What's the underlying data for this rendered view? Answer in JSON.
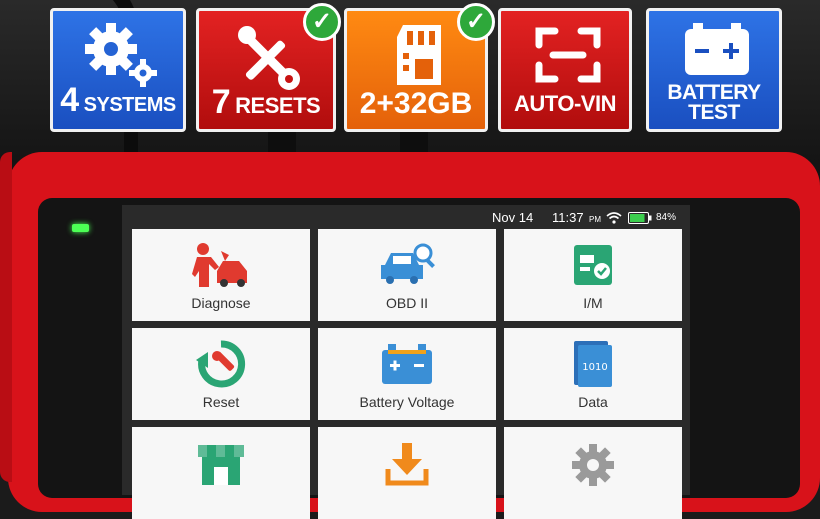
{
  "badges": [
    {
      "big": "4",
      "text": "SYSTEMS"
    },
    {
      "big": "7",
      "text": "RESETS"
    },
    {
      "big": "2+32GB",
      "text": ""
    },
    {
      "big": "",
      "text": "AUTO-VIN"
    },
    {
      "line1": "BATTERY",
      "line2": "TEST"
    }
  ],
  "status": {
    "date": "Nov 14",
    "time": "11:37",
    "ampm": "PM",
    "battery": "84%"
  },
  "tiles": [
    {
      "label": "Diagnose",
      "icon": "diagnose-icon"
    },
    {
      "label": "OBD II",
      "icon": "car-search-icon"
    },
    {
      "label": "I/M",
      "icon": "inspection-icon"
    },
    {
      "label": "Reset",
      "icon": "reset-wrench-icon"
    },
    {
      "label": "Battery Voltage",
      "icon": "battery-icon"
    },
    {
      "label": "Data",
      "icon": "data-file-icon"
    },
    {
      "label": "",
      "icon": "store-icon"
    },
    {
      "label": "",
      "icon": "download-icon"
    },
    {
      "label": "",
      "icon": "gear-icon"
    }
  ],
  "colors": {
    "red": "#d8121a",
    "blue": "#2e73e6",
    "orange": "#ff8a12",
    "green_check": "#2ea83a",
    "icon_red": "#e03a2f",
    "icon_blue": "#3a8fd6",
    "icon_green": "#2aa574"
  }
}
